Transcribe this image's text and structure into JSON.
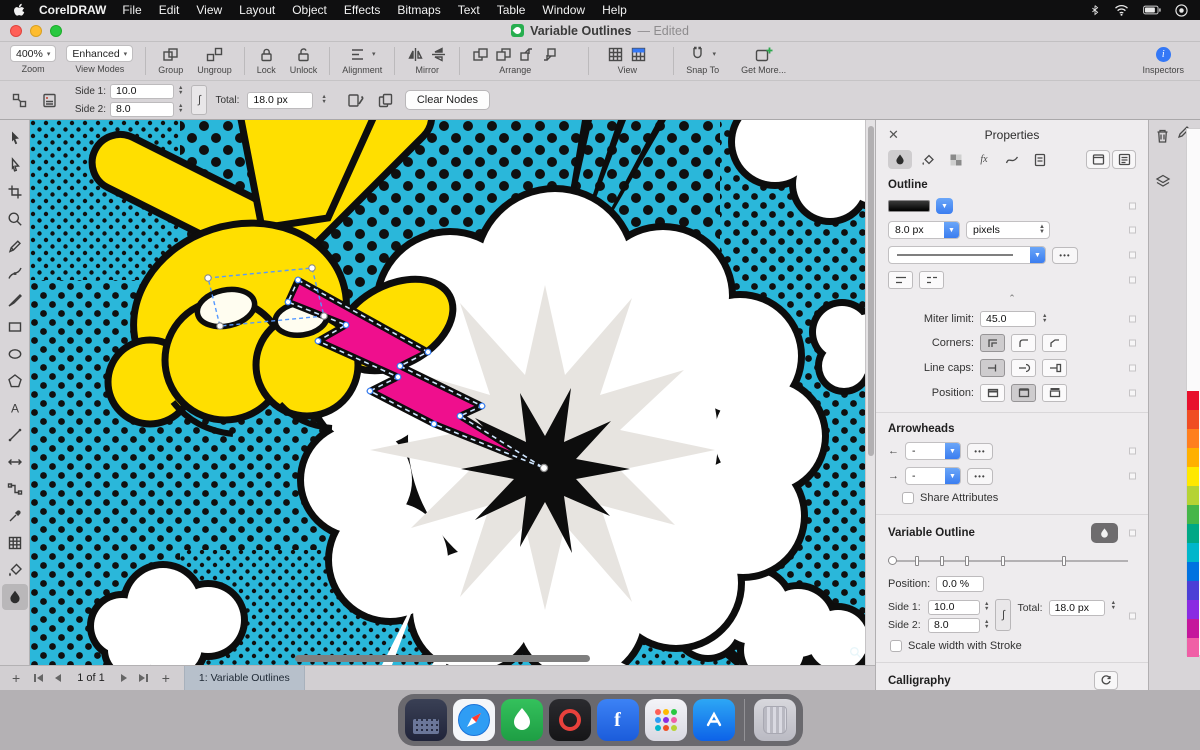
{
  "menu_bar": {
    "app_name": "CorelDRAW",
    "items": [
      "File",
      "Edit",
      "View",
      "Layout",
      "Object",
      "Effects",
      "Bitmaps",
      "Text",
      "Table",
      "Window",
      "Help"
    ]
  },
  "title_bar": {
    "doc_title": "Variable Outlines",
    "edited_label": "—  Edited"
  },
  "toolbar": {
    "zoom_value": "400%",
    "zoom_label": "Zoom",
    "view_modes_value": "Enhanced",
    "view_modes_label": "View Modes",
    "group_label": "Group",
    "ungroup_label": "Ungroup",
    "lock_label": "Lock",
    "unlock_label": "Unlock",
    "alignment_label": "Alignment",
    "mirror_label": "Mirror",
    "arrange_label": "Arrange",
    "view_label": "View",
    "snap_to_label": "Snap To",
    "get_more_label": "Get More...",
    "inspectors_label": "Inspectors"
  },
  "property_bar": {
    "side1_label": "Side 1:",
    "side1_value": "10.0",
    "side2_label": "Side 2:",
    "side2_value": "8.0",
    "total_label": "Total:",
    "total_value": "18.0 px",
    "clear_nodes_label": "Clear Nodes"
  },
  "inspector": {
    "title": "Properties",
    "outline_section": "Outline",
    "width_value": "8.0 px",
    "units_value": "pixels",
    "miter_label": "Miter limit:",
    "miter_value": "45.0",
    "corners_label": "Corners:",
    "line_caps_label": "Line caps:",
    "position_label": "Position:",
    "arrowheads_section": "Arrowheads",
    "arrow_start_value": "-",
    "arrow_end_value": "-",
    "more_label": "•••",
    "share_attributes_label": "Share Attributes",
    "variable_outline_section": "Variable Outline",
    "vo_position_label": "Position:",
    "vo_position_value": "0.0 %",
    "vo_side1_label": "Side 1:",
    "vo_side1_value": "10.0",
    "vo_side2_label": "Side 2:",
    "vo_side2_value": "8.0",
    "vo_total_label": "Total:",
    "vo_total_value": "18.0 px",
    "scale_width_label": "Scale width with Stroke",
    "calligraphy_section": "Calligraphy"
  },
  "status_bar": {
    "page_indicator": "1 of 1",
    "page_tab": "1: Variable Outlines"
  },
  "toolbox_tools": [
    "pick",
    "shape",
    "crop",
    "zoom",
    "freehand",
    "bezier",
    "artistic-media",
    "rectangle",
    "ellipse",
    "polygon",
    "text",
    "two-point-line",
    "dimension",
    "connector",
    "eyedropper",
    "mesh-fill",
    "smart-fill",
    "variable-outline"
  ],
  "palette": {
    "colors": [
      "#e8112d",
      "#f04e23",
      "#ff7f1e",
      "#ffb000",
      "#ffe800",
      "#b5d334",
      "#45b649",
      "#00a886",
      "#00b6cb",
      "#0072e0",
      "#4b3fd6",
      "#8a2be2",
      "#c5179c",
      "#f05fa6"
    ]
  },
  "dock": {
    "apps": [
      "display",
      "safari",
      "coreldraw",
      "photo-paint",
      "font-manager",
      "launchpad",
      "app-store",
      "trash"
    ]
  },
  "colors": {
    "accent_blue": "#3478f6",
    "canvas_cyan": "#2ab7da",
    "hand_yellow": "#ffdf00",
    "bolt_pink": "#ef0f8d"
  }
}
